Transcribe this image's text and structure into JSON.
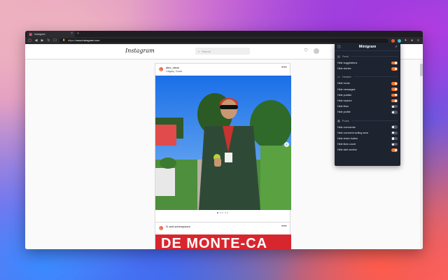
{
  "browser": {
    "tab_title": "Instagram",
    "url_prefix": "https://",
    "url_host": "www.instagram.com"
  },
  "instagram": {
    "logo": "Instagram",
    "search_placeholder": "Search",
    "posts": [
      {
        "username": "alex_olson",
        "location": "Calgary, Costa",
        "dots": 5,
        "active_dot": 1
      },
      {
        "username": "f1 and scherspaces",
        "banner_text": "DE MONTE-CA"
      }
    ]
  },
  "minigram": {
    "title": "Minigram",
    "sections": [
      {
        "title": "Feed",
        "items": [
          {
            "label": "Hide suggestions",
            "on": true
          },
          {
            "label": "Hide stories",
            "on": true
          }
        ]
      },
      {
        "title": "Header",
        "items": [
          {
            "label": "Hide home",
            "on": true
          },
          {
            "label": "Hide messages",
            "on": true
          },
          {
            "label": "Hide publish",
            "on": true
          },
          {
            "label": "Hide explore",
            "on": true
          },
          {
            "label": "Hide likes",
            "on": false
          },
          {
            "label": "Hide profile",
            "on": false
          }
        ]
      },
      {
        "title": "Posts",
        "items": [
          {
            "label": "Hide comments",
            "on": false
          },
          {
            "label": "Hide comment writing area",
            "on": false
          },
          {
            "label": "Hide share button",
            "on": false
          },
          {
            "label": "Hide likes count",
            "on": false
          },
          {
            "label": "Hide side section",
            "on": true
          }
        ]
      }
    ],
    "colors": {
      "toggle_on": "#f2782e",
      "toggle_off": "#55596a",
      "panel_bg": "#1e2330"
    }
  }
}
